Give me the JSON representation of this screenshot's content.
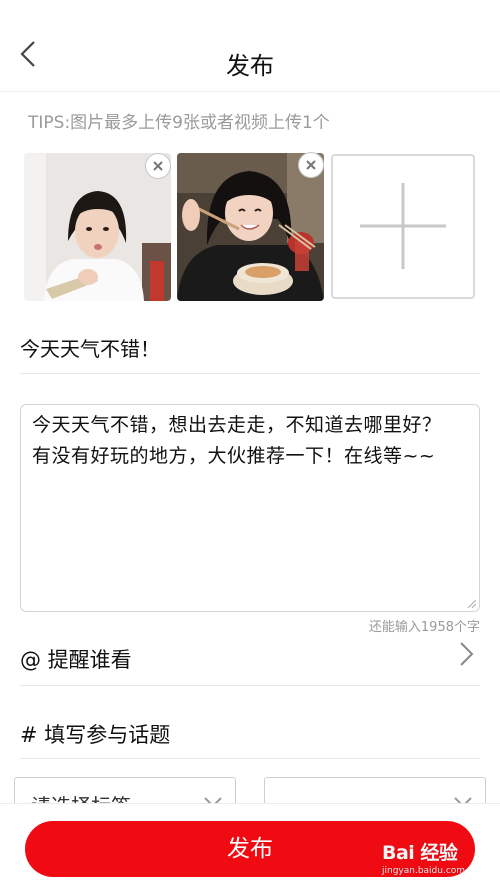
{
  "header": {
    "title": "发布",
    "back_icon": "chevron-left-icon"
  },
  "tips": "TIPS:图片最多上传9张或者视频上传1个",
  "media": {
    "add_icon": "plus-icon",
    "remove_icon": "close-icon"
  },
  "topic_title": "今天天气不错！",
  "content": {
    "line1": "今天天气不错，想出去走走，不知道去哪里好？",
    "line2": "有没有好玩的地方，大伙推荐一下！在线等~~",
    "counter": "还能输入1958个字"
  },
  "remind": {
    "label": "@ 提醒谁看",
    "chevron_icon": "chevron-right-icon"
  },
  "topic": {
    "label": "# 填写参与话题"
  },
  "tag_select": {
    "placeholder": "请选择标签",
    "second_value": ""
  },
  "footer": {
    "publish_label": "发布"
  },
  "watermark": {
    "brand": "Bai 经验",
    "sub": "jingyan.baidu.com"
  },
  "colors": {
    "accent": "#f00a12",
    "muted": "#9a9a9a"
  }
}
